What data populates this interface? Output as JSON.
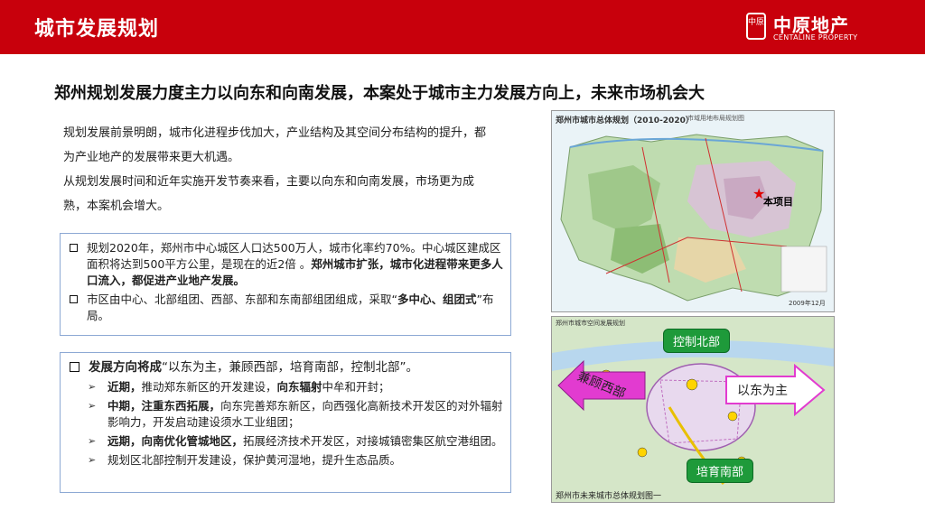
{
  "header": {
    "title": "城市发展规划",
    "logo_mark": "中原",
    "logo_cn": "中原地产",
    "logo_en": "CENTALINE PROPERTY"
  },
  "headline": "郑州规划发展力度主力以向东和向南发展，本案处于城市主力发展方向上，未来市场机会大",
  "intro": [
    "规划发展前景明朗，城市化进程步伐加大，产业结构及其空间分布结构的提升，都为产业地产的发展带来更大机遇。",
    "从规划发展时间和近年实施开发节奏来看，主要以向东和向南发展，市场更为成熟，本案机会增大。"
  ],
  "box1": [
    {
      "t1": "规划2020年，郑州市中心城区人口达500万人，城市化率约70%。中心城区建成区面积将达到500平方公里，是现在的近2倍 。",
      "b1": "郑州城市扩张，城市化进程带来更多人口流入，都促进产业地产发展。",
      "t2": ""
    },
    {
      "t1": "市区由中心、北部组团、西部、东部和东南部组团组成，采取“",
      "b1": "多中心、组团式",
      "t2": "”布局。"
    }
  ],
  "box2": {
    "main_bold": "发展方向将成",
    "main_text": "“以东为主，兼顾西部，培育南部，控制北部”。",
    "subs": [
      {
        "b1": "近期，",
        "t1": "推动郑东新区的开发建设，",
        "b2": "向东辐射",
        "t2": "中牟和开封；"
      },
      {
        "b1": "中期，注重东西拓展，",
        "t1": "向东完善郑东新区，向西强化高新技术开发区的对外辐射影响力，开发启动建设须水工业组团；",
        "b2": "",
        "t2": ""
      },
      {
        "b1": "远期，向南优化管城地区，",
        "t1": "拓展经济技术开发区，对接城镇密集区航空港组团。",
        "b2": "",
        "t2": ""
      },
      {
        "b1": "",
        "t1": "规划区北部控制开发建设，保护黄河湿地，提升生态品质。",
        "b2": "",
        "t2": ""
      }
    ]
  },
  "map1": {
    "title": "郑州市城市总体规划",
    "title_years": "（2010-2020）",
    "legend": "市域用地布局规划图",
    "project_label": "本项目",
    "date": "2009年12月"
  },
  "map2": {
    "header": "郑州市城市空间发展规划",
    "caption": "郑州市未来城市总体规划图一",
    "north": "控制北部",
    "south": "培育南部",
    "east": "以东为主",
    "west": "兼顾西部"
  },
  "colors": {
    "brand_red": "#c8000c",
    "tag_green": "#1e9a3a",
    "arrow_magenta": "#e23bd0",
    "star_red": "#e00000"
  }
}
